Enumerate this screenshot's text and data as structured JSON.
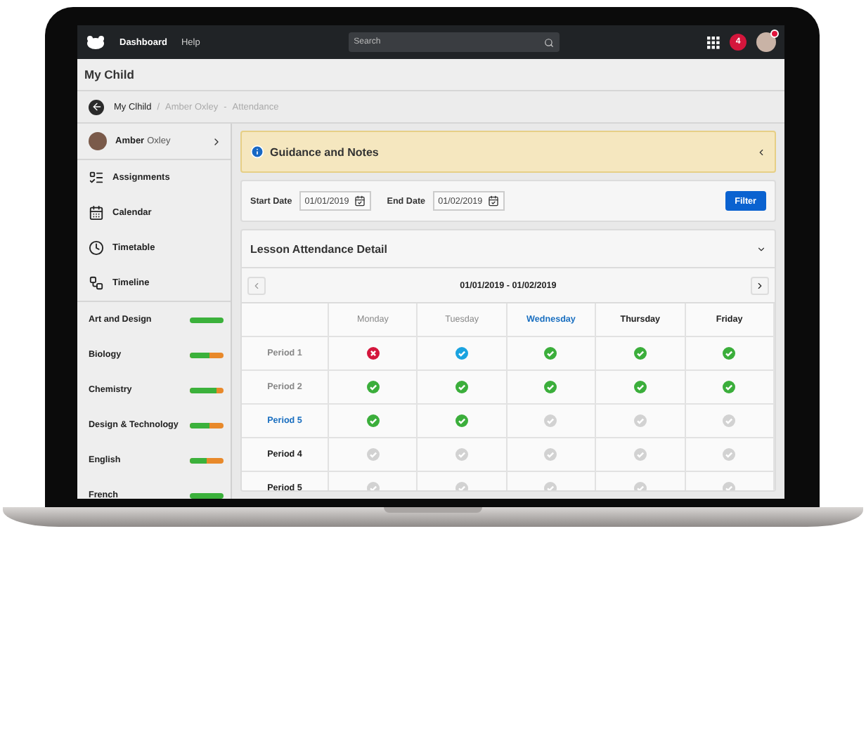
{
  "topbar": {
    "nav": [
      {
        "label": "Dashboard",
        "selected": true
      },
      {
        "label": "Help",
        "selected": false
      }
    ],
    "search": {
      "placeholder": "Search"
    },
    "notifications": "4"
  },
  "page_title": "My Child",
  "breadcrumb": [
    {
      "text": "My Clhild",
      "kind": "link"
    },
    {
      "text": "/",
      "kind": "separator"
    },
    {
      "text": "Amber Oxley",
      "kind": "muted"
    },
    {
      "text": "-",
      "kind": "separator"
    },
    {
      "text": "Attendance",
      "kind": "muted"
    }
  ],
  "student": {
    "first_name": "Amber",
    "last_name": "Oxley"
  },
  "menu": [
    {
      "label": "Assignments",
      "kind": "list"
    },
    {
      "label": "Calendar",
      "kind": "calendar"
    },
    {
      "label": "Timetable",
      "kind": "clock"
    },
    {
      "label": "Timeline",
      "kind": "diagram"
    }
  ],
  "subjects": [
    {
      "name": "Art and Design",
      "level": 1
    },
    {
      "name": "Biology",
      "level": 0.6
    },
    {
      "name": "Chemistry",
      "level": 0.8
    },
    {
      "name": "Design & Technology",
      "level": 0.6
    },
    {
      "name": "English",
      "level": 0.5
    },
    {
      "name": "French",
      "level": 1
    }
  ],
  "guidance": {
    "title": "Guidance and Notes"
  },
  "filter": {
    "start_label": "Start Date",
    "start_value": "01/01/2019",
    "end_label": "End Date",
    "end_value": "01/02/2019",
    "button": "Filter"
  },
  "attendance": {
    "title": "Lesson Attendance Detail",
    "range": "01/01/2019 - 01/02/2019",
    "days": [
      {
        "label": "Monday",
        "kind": "past"
      },
      {
        "label": "Tuesday",
        "kind": "past"
      },
      {
        "label": "Wednesday",
        "kind": "current"
      },
      {
        "label": "Thursday",
        "kind": "upcoming"
      },
      {
        "label": "Friday",
        "kind": "upcoming"
      }
    ],
    "periods": [
      {
        "label": "Period 1",
        "kind": "past",
        "cells": [
          {
            "kind": "absent"
          },
          {
            "kind": "late"
          },
          {
            "kind": "present"
          },
          {
            "kind": "present"
          },
          {
            "kind": "present"
          }
        ]
      },
      {
        "label": "Period 2",
        "kind": "past",
        "cells": [
          {
            "kind": "present"
          },
          {
            "kind": "present"
          },
          {
            "kind": "present"
          },
          {
            "kind": "present"
          },
          {
            "kind": "present"
          }
        ]
      },
      {
        "label": "Period 5",
        "kind": "current",
        "cells": [
          {
            "kind": "present"
          },
          {
            "kind": "present"
          },
          {
            "kind": "pending"
          },
          {
            "kind": "pending"
          },
          {
            "kind": "pending"
          }
        ]
      },
      {
        "label": "Period 4",
        "kind": "upcoming",
        "cells": [
          {
            "kind": "pending"
          },
          {
            "kind": "pending"
          },
          {
            "kind": "pending"
          },
          {
            "kind": "pending"
          },
          {
            "kind": "pending"
          }
        ]
      },
      {
        "label": "Period 5",
        "kind": "upcoming",
        "cells": [
          {
            "kind": "pending"
          },
          {
            "kind": "pending"
          },
          {
            "kind": "pending"
          },
          {
            "kind": "pending"
          },
          {
            "kind": "pending"
          }
        ]
      }
    ]
  }
}
